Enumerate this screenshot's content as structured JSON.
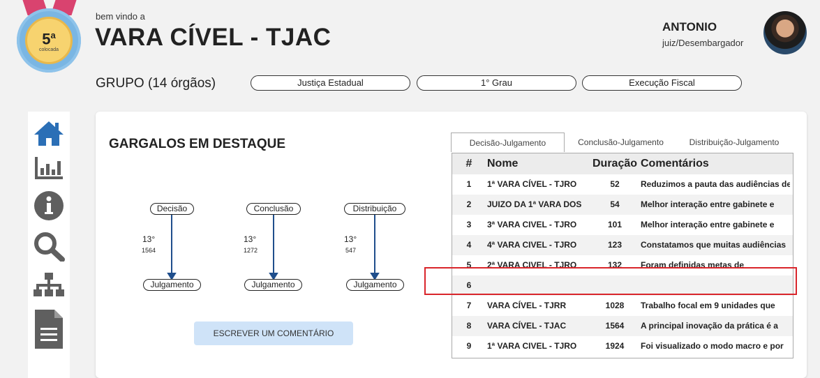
{
  "medal": {
    "rank": "5",
    "rank_suffix": "a",
    "label": "colocada"
  },
  "header": {
    "welcome": "bem vindo a",
    "title": "VARA CÍVEL - TJAC",
    "group": "GRUPO (14 órgãos)",
    "filters": [
      "Justiça Estadual",
      "1° Grau",
      "Execução Fiscal"
    ]
  },
  "user": {
    "name": "ANTONIO",
    "role": "juiz/Desembargador"
  },
  "sidebar": {
    "icons": [
      "home-icon",
      "bar-chart-icon",
      "info-icon",
      "search-icon",
      "org-chart-icon",
      "document-icon"
    ],
    "accent": "#2b6fb6",
    "gray": "#5f5f5f"
  },
  "main": {
    "title": "GARGALOS EM DESTAQUE",
    "flows": [
      {
        "from": "Decisão",
        "to": "Julgamento",
        "rank": "13°",
        "value": "1564"
      },
      {
        "from": "Conclusão",
        "to": "Julgamento",
        "rank": "13°",
        "value": "1272"
      },
      {
        "from": "Distribuição",
        "to": "Julgamento",
        "rank": "13°",
        "value": "547"
      }
    ],
    "comment_button": "ESCREVER UM COMENTÁRIO",
    "tabs": [
      "Decisão-Julgamento",
      "Conclusão-Julgamento",
      "Distribuição-Julgamento"
    ],
    "active_tab": "Decisão-Julgamento",
    "table": {
      "headers": [
        "#",
        "Nome",
        "Duração",
        "Comentários"
      ],
      "rows": [
        {
          "rank": "1",
          "name": "1ª VARA CÍVEL - TJRO",
          "duration": "52",
          "comment": "Reduzimos a pauta das audiências de"
        },
        {
          "rank": "2",
          "name": "JUIZO DA 1ª VARA DOS",
          "duration": "54",
          "comment": "Melhor interação entre gabinete e"
        },
        {
          "rank": "3",
          "name": "3ª VARA CIVEL - TJRO",
          "duration": "101",
          "comment": "Melhor interação entre gabinete e"
        },
        {
          "rank": "4",
          "name": "4ª VARA CIVEL - TJRO",
          "duration": "123",
          "comment": "Constatamos que muitas audiências"
        },
        {
          "rank": "5",
          "name": "2ª VARA CIVEL - TJRO",
          "duration": "132",
          "comment": "Foram definidas metas de"
        },
        {
          "rank": "6",
          "name": "",
          "duration": "",
          "comment": ""
        },
        {
          "rank": "7",
          "name": "VARA CÍVEL - TJRR",
          "duration": "1028",
          "comment": "Trabalho focal em 9 unidades que"
        },
        {
          "rank": "8",
          "name": "VARA CÍVEL - TJAC",
          "duration": "1564",
          "comment": "A principal inovação da prática é a"
        },
        {
          "rank": "9",
          "name": "1ª VARA CIVEL - TJRO",
          "duration": "1924",
          "comment": "Foi visualizado o modo macro e por"
        }
      ]
    }
  },
  "colors": {
    "highlight": "#d9252b",
    "arrow": "#1f4e8c",
    "button_bg": "#cfe3f8"
  }
}
